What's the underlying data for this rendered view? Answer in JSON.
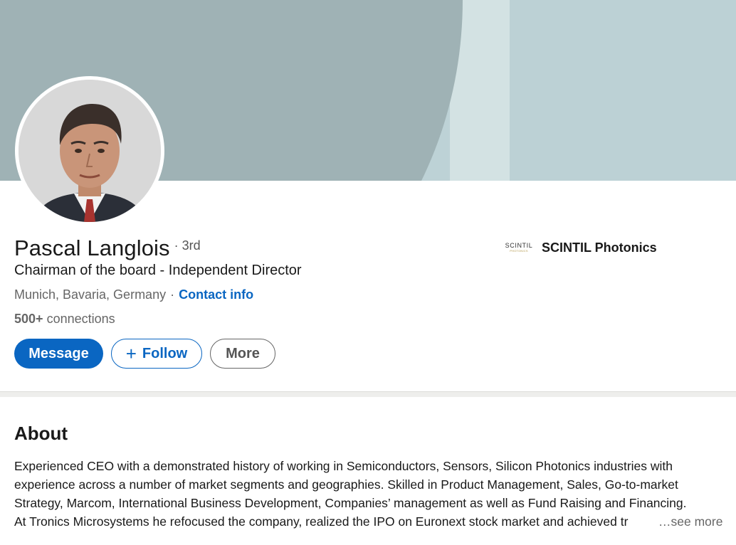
{
  "profile": {
    "name": "Pascal Langlois",
    "degree": "· 3rd",
    "headline": "Chairman of the board - Independent Director",
    "location": "Munich, Bavaria, Germany",
    "location_separator": "·",
    "contact_info_label": "Contact info",
    "connections_count": "500+",
    "connections_label": "connections"
  },
  "actions": {
    "message_label": "Message",
    "follow_icon": "+",
    "follow_label": "Follow",
    "more_label": "More"
  },
  "company": {
    "logo_text": "SCINTIL",
    "logo_subtext": "PHOTONICS",
    "name": "SCINTIL Photonics"
  },
  "about": {
    "title": "About",
    "lines": [
      "Experienced CEO with a demonstrated history of working in Semiconductors, Sensors, Silicon Photonics industries with",
      "experience across a number of market segments and geographies. Skilled in Product Management, Sales, Go-to-market",
      "Strategy, Marcom, International Business Development, Companies’ management as well as Fund Raising and Financing.",
      "At Tronics Microsystems he refocused the company, realized the IPO on Euronext stock market and achieved tr"
    ],
    "see_more_label": "…see more"
  },
  "colors": {
    "accent": "#0a66c2",
    "banner_dark": "#9fb2b5",
    "banner_light": "#bcd1d5",
    "banner_band": "#d3e2e3"
  },
  "icons": {
    "avatar": "profile-photo",
    "company_logo": "scintil-logo"
  }
}
